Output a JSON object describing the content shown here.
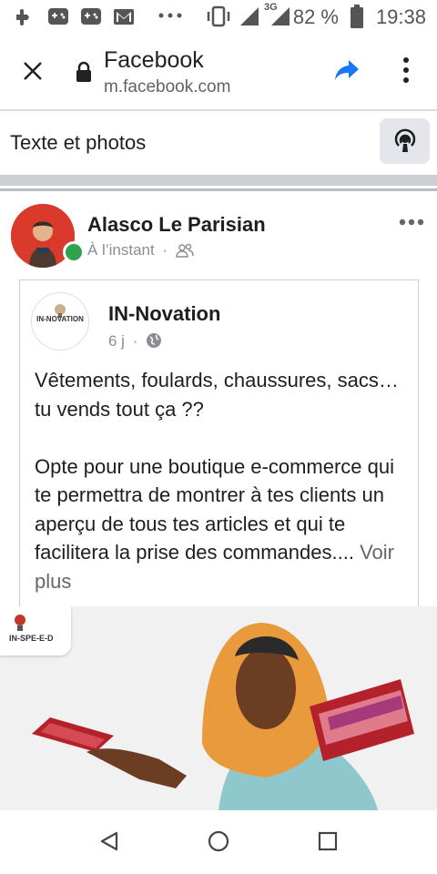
{
  "status_bar": {
    "time": "19:38",
    "battery_percent": "82 %",
    "network_type": "3G",
    "icons": [
      "puzzle-icon",
      "gamepad-icon",
      "gamepad-icon",
      "gmail-icon",
      "more-dots-icon",
      "vibrate-icon",
      "signal-icon",
      "signal-icon",
      "battery-icon"
    ]
  },
  "browser": {
    "title": "Facebook",
    "url": "m.facebook.com",
    "icons": [
      "close-icon",
      "lock-icon",
      "share-icon",
      "overflow-menu-icon"
    ]
  },
  "composer": {
    "label": "Texte et photos",
    "live_icon": "live-video-icon"
  },
  "post": {
    "author": "Alasco Le Parisian",
    "time": "À l’instant",
    "audience_icon": "friends-icon",
    "menu_icon": "more-horizontal-icon",
    "shared": {
      "page_name": "IN-Novation",
      "logo_text": "IN-NOVATION",
      "time": "6 j",
      "audience_icon": "globe-icon",
      "text_p1": "Vêtements, foulards, chaussures, sacs… tu vends tout ça ??",
      "text_p2": "Opte pour une boutique e-commerce qui te permettra de montrer à tes clients un aperçu de tous tes articles et qui te facilitera la prise des commandes....",
      "see_more": "Voir plus"
    },
    "photo": {
      "badge_text": "IN-SPE-E-D"
    }
  },
  "nav_bar": {
    "icons": [
      "back-icon",
      "home-icon",
      "recents-icon"
    ]
  },
  "colors": {
    "accent_blue": "#1877f2",
    "online_green": "#31a24c",
    "avatar_red": "#d93a2b",
    "text_gray": "#65676b"
  }
}
